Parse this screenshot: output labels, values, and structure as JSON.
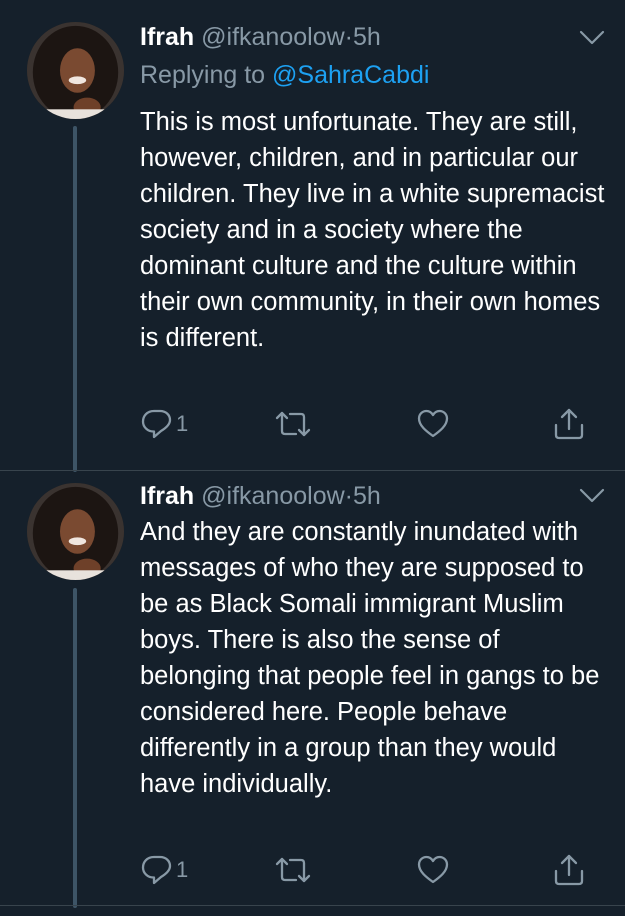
{
  "tweets": [
    {
      "name": "Ifrah",
      "handle": "@ifkanoolow",
      "separator": "·",
      "time": "5h",
      "reply_prefix": "Replying to",
      "reply_to": "@SahraCabdi",
      "text": "This is most unfortunate. They are still, however, children, and in particular our children. They live in a white supremacist society and in a society where the dominant culture and the culture within their own community, in their own homes is different.",
      "reply_count": "1",
      "icons": [
        "reply-icon",
        "retweet-icon",
        "like-icon",
        "share-icon",
        "chevron-down-icon"
      ]
    },
    {
      "name": "Ifrah",
      "handle": "@ifkanoolow",
      "separator": "·",
      "time": "5h",
      "text": "And they are constantly inundated with messages of who they are supposed to be as Black Somali immigrant Muslim boys. There is also the sense of belonging that people feel in gangs to be considered here. People behave differently in a group than they would have individually.",
      "reply_count": "1",
      "icons": [
        "reply-icon",
        "retweet-icon",
        "like-icon",
        "share-icon",
        "chevron-down-icon"
      ]
    }
  ],
  "colors": {
    "background": "#15202b",
    "primary_text": "#ffffff",
    "secondary_text": "#8899a6",
    "link": "#1da1f2",
    "divider": "#38444d",
    "thread_line": "#3d5466"
  }
}
